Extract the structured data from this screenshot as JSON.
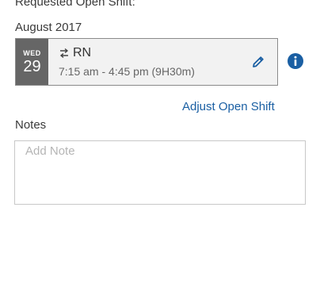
{
  "header": {
    "requested_label": "Requested Open Shift:",
    "month_label": "August 2017"
  },
  "shift": {
    "day_name": "WED",
    "day_number": "29",
    "role": "RN",
    "time": "7:15 am - 4:45 pm (9H30m)"
  },
  "actions": {
    "adjust_label": "Adjust Open Shift"
  },
  "notes": {
    "label": "Notes",
    "value": "",
    "placeholder": "Add Note"
  },
  "icons": {
    "swap": "swap-arrows-icon",
    "edit": "pencil-icon",
    "info": "info-icon"
  },
  "colors": {
    "accent": "#1a5fa3",
    "date_block": "#666666",
    "card_background": "#f2f2f2"
  }
}
